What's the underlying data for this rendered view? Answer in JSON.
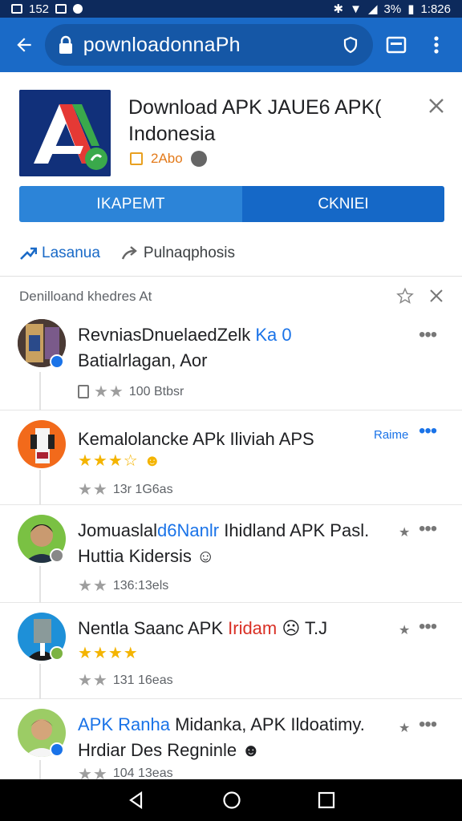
{
  "status_bar": {
    "left_text": "152",
    "battery": "3%",
    "time": "1:826"
  },
  "toolbar": {
    "url": "pownloadonnaPh"
  },
  "app_card": {
    "title": "Download APK JAUE6 APK( Indonesia",
    "meta_text": "2Abo",
    "install_label": "IKAPEMT",
    "cancel_label": "CKNIEI"
  },
  "tabs": [
    {
      "label": "Lasanua"
    },
    {
      "label": "Pulnaqphosis"
    }
  ],
  "section": {
    "title": "Denilloand khedres At"
  },
  "list": [
    {
      "title_plain": "RevniasDnuelaedZelk ",
      "title_highlight": "Ka 0",
      "title_line2": "Batialrlagan, Aor",
      "meta": "100 Btbsr"
    },
    {
      "title_plain": "Kemalolancke APk Iliviah APS",
      "link": "Raime",
      "meta": "13r 1G6as"
    },
    {
      "title_plain": "Jomuaslal",
      "title_highlight": "d6Nanlr",
      "title_rest": " Ihidland APK Pasl.",
      "title_line2": "Huttia Kidersis",
      "meta": "136:13els"
    },
    {
      "title_plain": "Nentla Saanc APK ",
      "title_highlight2": "Iridam",
      "title_rest": " T.J",
      "meta": "131 16eas"
    },
    {
      "title_highlight": "APK Ranha",
      "title_rest": " Midanka, APK Ildoatimy.",
      "title_line2": "Hrdiar Des Regninle",
      "meta": "104 13eas"
    }
  ],
  "colors": {
    "toolbar": "#1a6ac7",
    "accent": "#1a73e8",
    "star_gold": "#f4b400"
  }
}
